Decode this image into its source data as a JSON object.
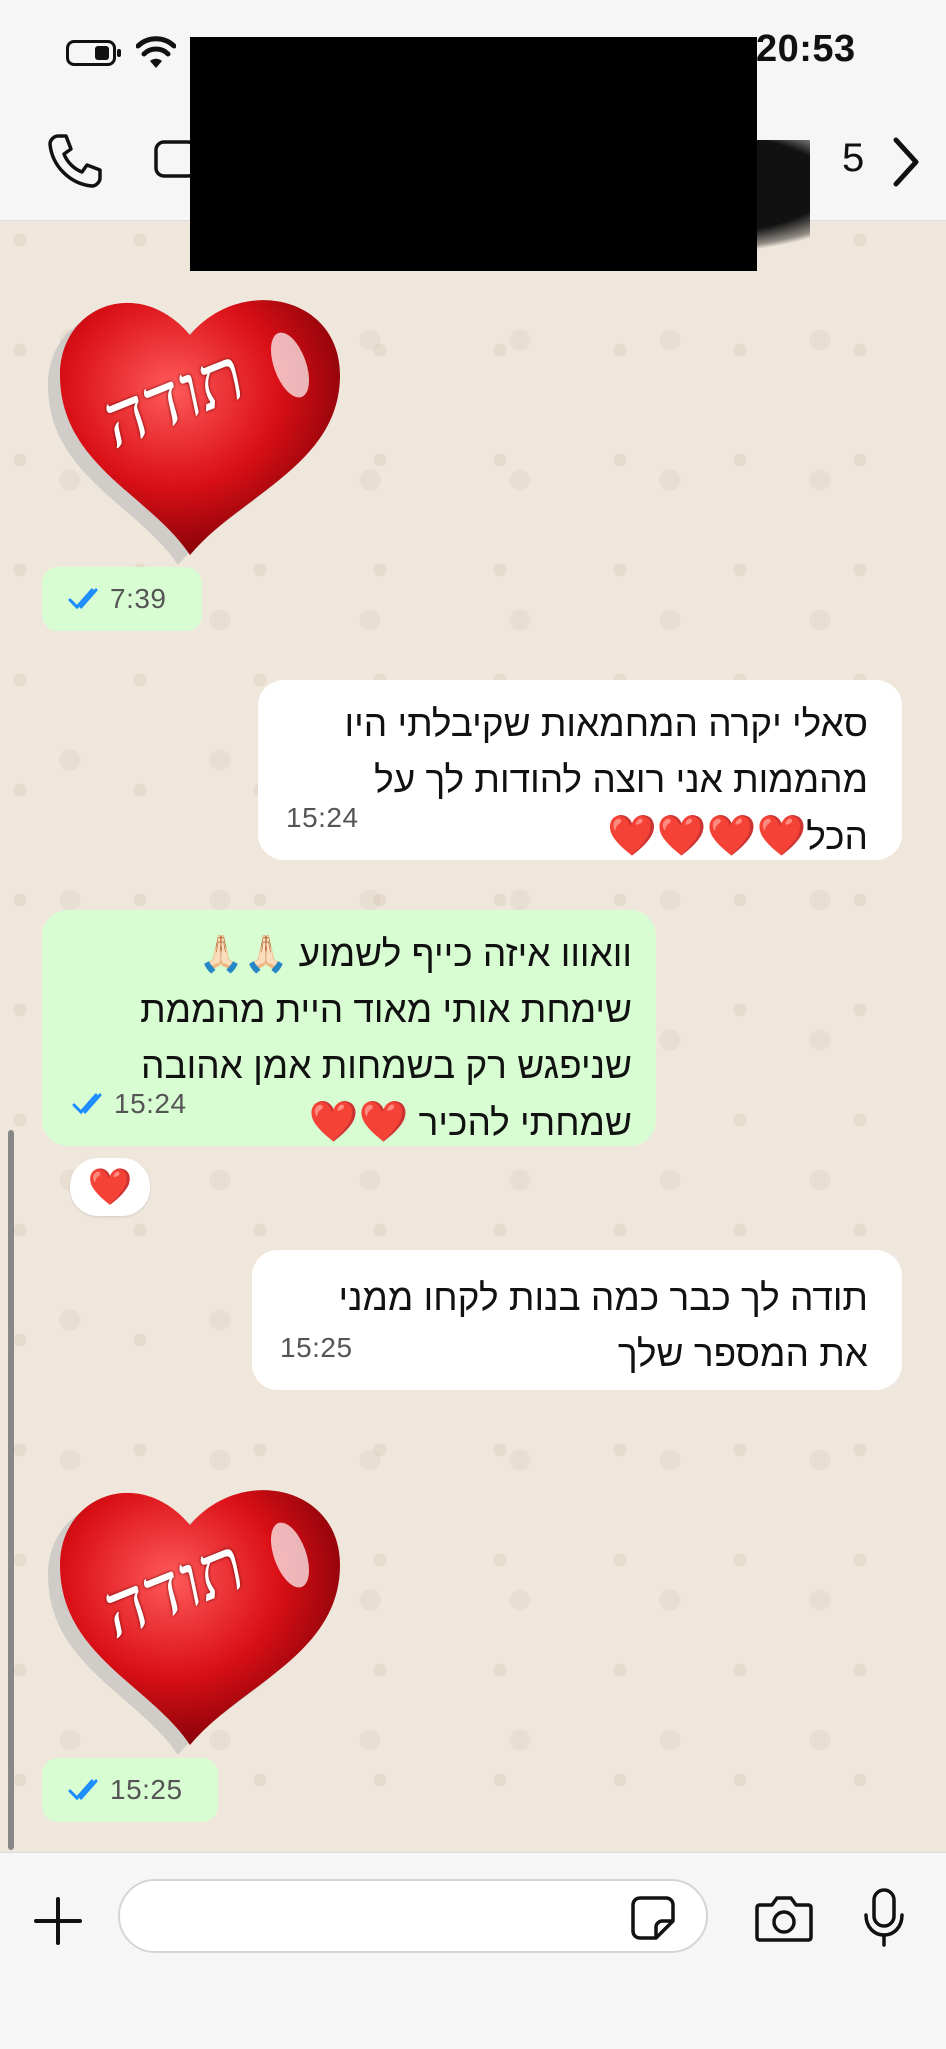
{
  "status_bar": {
    "time": "20:53"
  },
  "header": {
    "unread_count": "5"
  },
  "messages": [
    {
      "type": "sticker",
      "direction": "outgoing",
      "sticker_text": "תודה",
      "time": "7:39",
      "status": "read"
    },
    {
      "type": "text",
      "direction": "incoming",
      "lines": [
        "סאלי יקרה המחמאות שקיבלתי היו",
        "מהממות אני רוצה להודות לך על",
        "הכל"
      ],
      "emoji_line_suffix": "❤️❤️❤️❤️",
      "time": "15:24"
    },
    {
      "type": "text",
      "direction": "outgoing",
      "lines": [
        "וואווו איזה כייף לשמוע",
        "שימחת אותי מאוד היית מהממת",
        "שניפגש רק בשמחות אמן אהובה",
        "שמחתי להכיר"
      ],
      "line1_emoji": "🙏🏻🙏🏻",
      "line4_emoji": "❤️❤️",
      "time": "15:24",
      "status": "read",
      "reaction": "❤️"
    },
    {
      "type": "text",
      "direction": "incoming",
      "lines": [
        "תודה לך כבר כמה בנות לקחו ממני",
        "את המספר שלך"
      ],
      "time": "15:25"
    },
    {
      "type": "sticker",
      "direction": "outgoing",
      "sticker_text": "תודה",
      "time": "15:25",
      "status": "read"
    }
  ],
  "composer": {
    "placeholder": ""
  },
  "colors": {
    "outgoing_bubble": "#d8fdd2",
    "incoming_bubble": "#ffffff",
    "read_ticks": "#1a8cff",
    "wallpaper": "#efe7dc"
  },
  "icons": [
    "battery-icon",
    "wifi-icon",
    "call-icon",
    "video-icon",
    "forward-chevron-icon",
    "double-check-icon",
    "plus-icon",
    "sticker-icon",
    "camera-icon",
    "mic-icon"
  ]
}
